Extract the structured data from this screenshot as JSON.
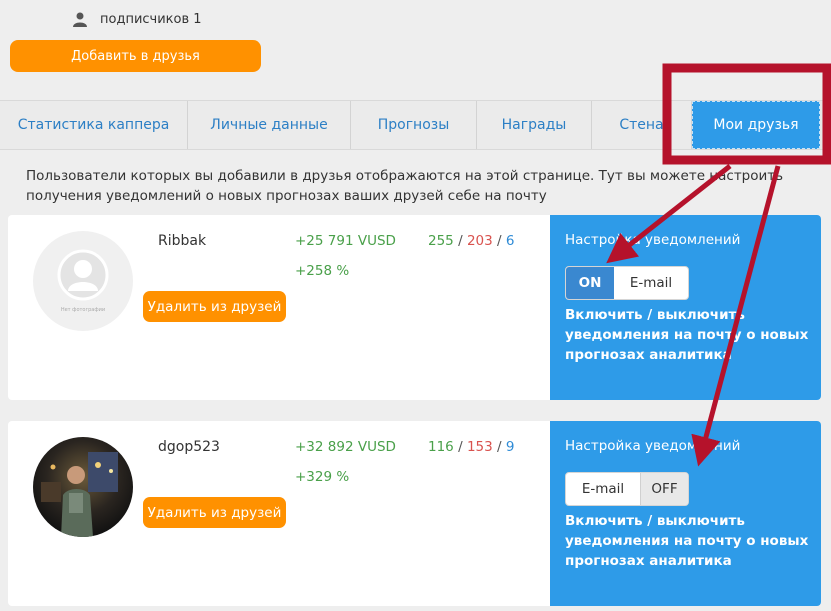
{
  "header": {
    "subscribers_label": "подписчиков 1",
    "add_friend_label": "Добавить в друзья"
  },
  "tabs": [
    {
      "label": "Статистика каппера"
    },
    {
      "label": "Личные данные"
    },
    {
      "label": "Прогнозы"
    },
    {
      "label": "Награды"
    },
    {
      "label": "Стена"
    },
    {
      "label": "Мои друзья",
      "active": true
    }
  ],
  "intro_text": "Пользователи которых вы добавили в друзья отображаются на этой странице. Тут вы можете настроить получения уведомлений о новых прогнозах ваших друзей себе на почту",
  "friends": [
    {
      "username": "Ribbak",
      "profit": "+25 791 VUSD",
      "roi": "+258 %",
      "wins": "255",
      "losses": "203",
      "returns": "6",
      "remove_label": "Удалить из друзей",
      "no_photo_label": "Нет фотографии",
      "notify": {
        "title": "Настройка уведомлений",
        "on_label": "ON",
        "email_label": "E-mail",
        "description": "Включить / выключить уведомления на почту о новых прогнозах аналитика"
      }
    },
    {
      "username": "dgop523",
      "profit": "+32 892 VUSD",
      "roi": "+329 %",
      "wins": "116",
      "losses": "153",
      "returns": "9",
      "remove_label": "Удалить из друзей",
      "notify": {
        "title": "Настройка уведомлений",
        "email_label": "E-mail",
        "off_label": "OFF",
        "description": "Включить / выключить уведомления на почту о новых прогнозах аналитика"
      }
    }
  ],
  "colors": {
    "accent_orange": "#ff9100",
    "accent_blue": "#2e9be8",
    "annotation_red": "#b5122b",
    "positive_green": "#4aa04a",
    "negative_red": "#d9534f"
  },
  "icons": {
    "subscribers": "user-icon",
    "placeholder_avatar": "person-silhouette-icon"
  }
}
